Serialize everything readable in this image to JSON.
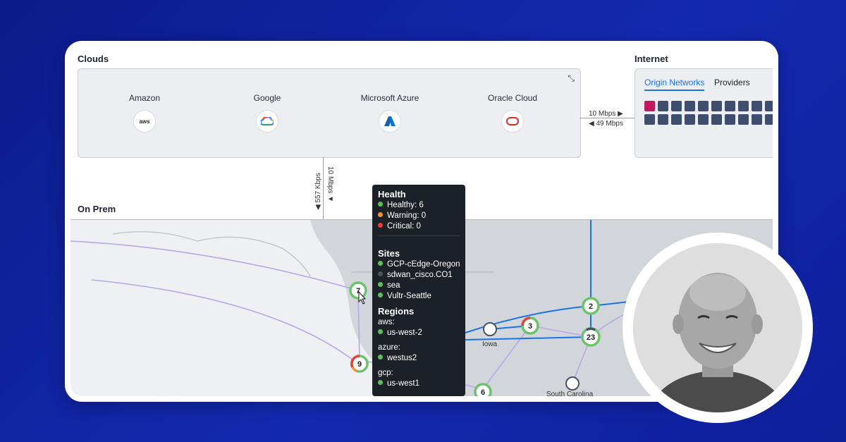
{
  "clouds": {
    "title": "Clouds",
    "providers": [
      {
        "name": "Amazon",
        "logo_text": "aws",
        "icon": "aws-icon"
      },
      {
        "name": "Google",
        "icon": "google-cloud-icon"
      },
      {
        "name": "Microsoft Azure",
        "icon": "azure-icon"
      },
      {
        "name": "Oracle Cloud",
        "icon": "oracle-icon"
      }
    ]
  },
  "links": {
    "cloud_internet_up": "10 Mbps ▶",
    "cloud_internet_down": "◀ 49 Mbps",
    "cloud_onprem_down": "10 Mbps ▼",
    "cloud_onprem_up": "◀ 557 Kbps"
  },
  "internet": {
    "title": "Internet",
    "tabs": [
      "Origin Networks",
      "Providers"
    ],
    "active_tab": "Origin Networks"
  },
  "onprem": {
    "title": "On Prem"
  },
  "map": {
    "nodes": [
      {
        "label": "7"
      },
      {
        "label": "9"
      },
      {
        "label": "3"
      },
      {
        "label": "2"
      },
      {
        "label": "23"
      },
      {
        "label": "6"
      }
    ],
    "place_labels": [
      "Iowa",
      "South Carolina"
    ]
  },
  "tooltip": {
    "health_title": "Health",
    "health": [
      {
        "label": "Healthy: 6",
        "color": "#5cc15c"
      },
      {
        "label": "Warning: 0",
        "color": "#f0962e"
      },
      {
        "label": "Critical: 0",
        "color": "#e5413b"
      }
    ],
    "sites_title": "Sites",
    "sites": [
      {
        "label": "GCP-cEdge-Oregon",
        "color": "#5cc15c"
      },
      {
        "label": "sdwan_cisco.CO1",
        "color": "#4a5160"
      },
      {
        "label": "sea",
        "color": "#5cc15c"
      },
      {
        "label": "Vultr-Seattle",
        "color": "#5cc15c"
      }
    ],
    "regions_title": "Regions",
    "regions": [
      {
        "provider": "aws:",
        "region": "us-west-2"
      },
      {
        "provider": "azure:",
        "region": "westus2"
      },
      {
        "provider": "gcp:",
        "region": "us-west1"
      }
    ]
  },
  "colors": {
    "background": "#1329b0",
    "accent": "#1a73e8",
    "healthy": "#5cc15c",
    "critical_square": "#c2185b",
    "square": "#3f4d6e"
  }
}
